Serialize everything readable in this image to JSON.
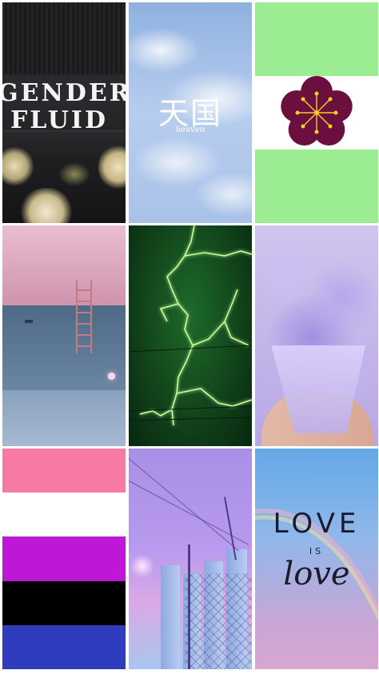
{
  "collage": {
    "tiles": [
      {
        "id": "sweatshirt",
        "lines": [
          "GENDER",
          "FLUID"
        ]
      },
      {
        "id": "sky",
        "kanji": "天国",
        "caption": "heaven"
      },
      {
        "id": "flower-flag",
        "colors": [
          "#9cec93",
          "#ffffff",
          "#9cec93"
        ],
        "flower_color": "#6b0f3e",
        "stamen_color": "#f5d020"
      },
      {
        "id": "pool"
      },
      {
        "id": "lightning"
      },
      {
        "id": "cotton-candy"
      },
      {
        "id": "genderfluid-flag",
        "colors": [
          "#f77aa4",
          "#ffffff",
          "#bd18d6",
          "#000000",
          "#303cbe"
        ]
      },
      {
        "id": "industrial"
      },
      {
        "id": "love-is-love",
        "line1": "LOVE",
        "line2": "IS",
        "line3": "love"
      }
    ]
  }
}
